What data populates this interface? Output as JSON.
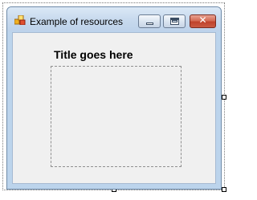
{
  "window": {
    "title": "Example of resources",
    "icon": "app-icon",
    "controls": {
      "minimize": "minimize-icon",
      "maximize": "maximize-icon",
      "close": "✕"
    }
  },
  "form": {
    "title": "Title goes here"
  },
  "colors": {
    "titlebar": "#c8daee",
    "client": "#f0f0f0",
    "close_button": "#c95a43"
  }
}
